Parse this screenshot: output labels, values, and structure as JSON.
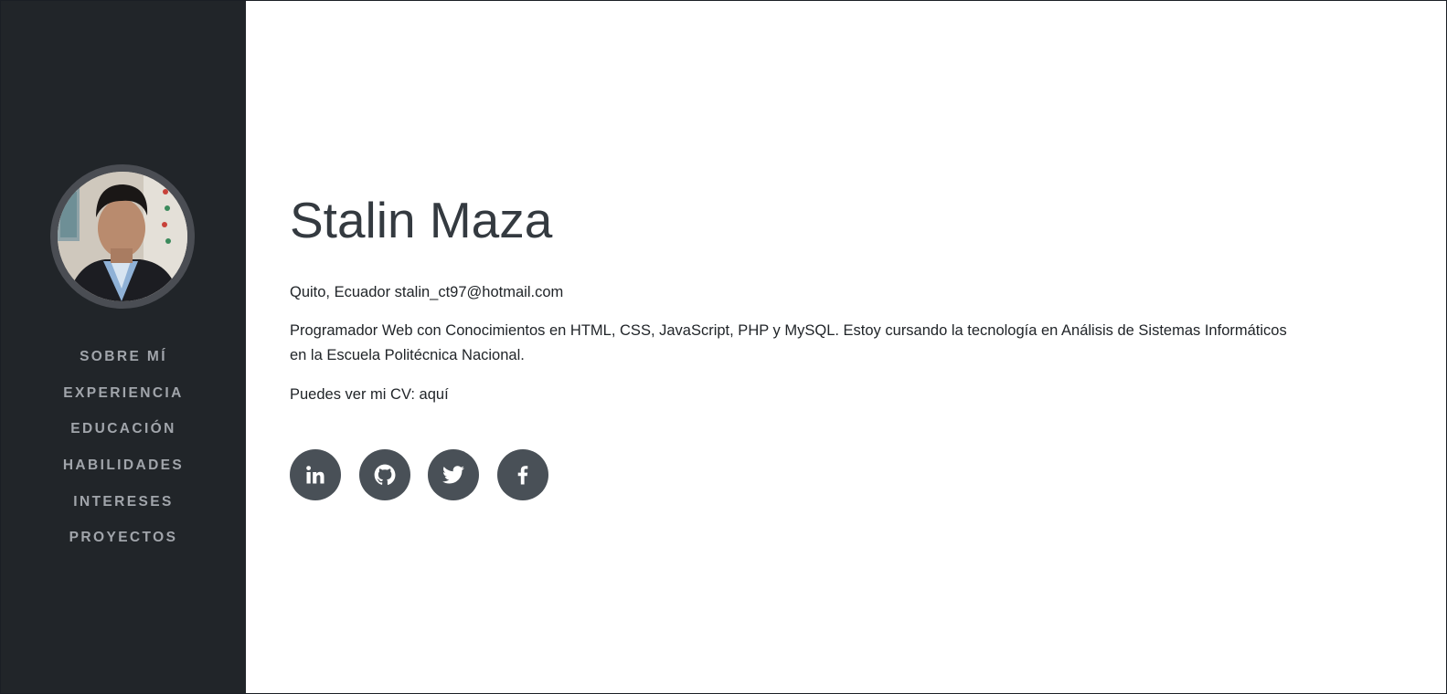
{
  "sidebar": {
    "nav": [
      {
        "label": "SOBRE MÍ"
      },
      {
        "label": "EXPERIENCIA"
      },
      {
        "label": "EDUCACIÓN"
      },
      {
        "label": "HABILIDADES"
      },
      {
        "label": "INTERESES"
      },
      {
        "label": "PROYECTOS"
      }
    ]
  },
  "about": {
    "name": "Stalin Maza",
    "location": "Quito, Ecuador",
    "email": "stalin_ct97@hotmail.com",
    "bio": "Programador Web con Conocimientos en HTML, CSS, JavaScript, PHP y MySQL. Estoy cursando la tecnología en Análisis de Sistemas Informáticos en la Escuela Politécnica Nacional.",
    "cv_prefix": "Puedes ver mi CV:",
    "cv_link": "aquí"
  },
  "social": [
    {
      "icon": "linkedin-icon"
    },
    {
      "icon": "github-icon"
    },
    {
      "icon": "twitter-icon"
    },
    {
      "icon": "facebook-icon"
    }
  ],
  "colors": {
    "sidebar_bg": "#212529",
    "nav_text": "#a1a5ab",
    "social_bg": "#495057",
    "heading": "#343a40",
    "body_text": "#212529"
  }
}
